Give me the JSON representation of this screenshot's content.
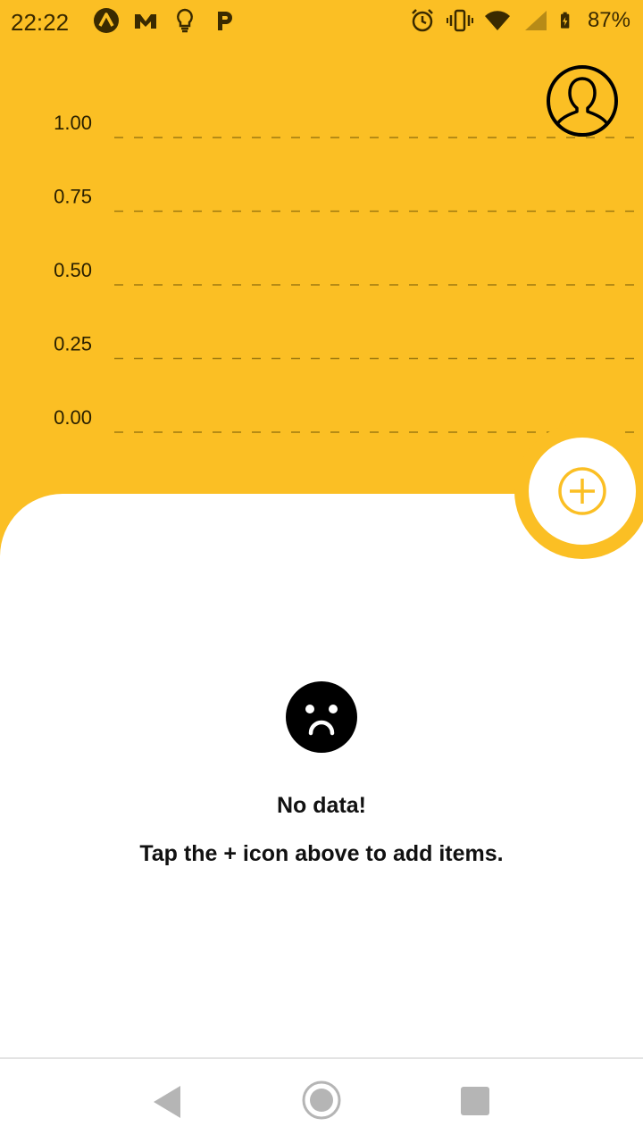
{
  "status_bar": {
    "time": "22:22",
    "left_icons": [
      "app-a-icon",
      "app-m-icon",
      "lightbulb-icon",
      "app-p-icon"
    ],
    "right_icons": [
      "alarm-icon",
      "vibrate-icon",
      "wifi-icon",
      "signal-icon",
      "battery-charging-icon"
    ],
    "battery_text": "87%"
  },
  "colors": {
    "accent": "#FBBF24",
    "text": "#111111",
    "nav_icon": "#B5B5B5"
  },
  "chart_data": {
    "type": "line",
    "y_ticks": [
      "1.00",
      "0.75",
      "0.50",
      "0.25",
      "0.00"
    ],
    "ylim": [
      0,
      1
    ],
    "grid": "dashed-horizontal",
    "series": []
  },
  "empty_state": {
    "icon": "sad-face-icon",
    "title": "No data!",
    "subtitle": "Tap the + icon above to add items."
  },
  "actions": {
    "add_icon": "add-circle-icon",
    "profile_icon": "profile-icon"
  }
}
